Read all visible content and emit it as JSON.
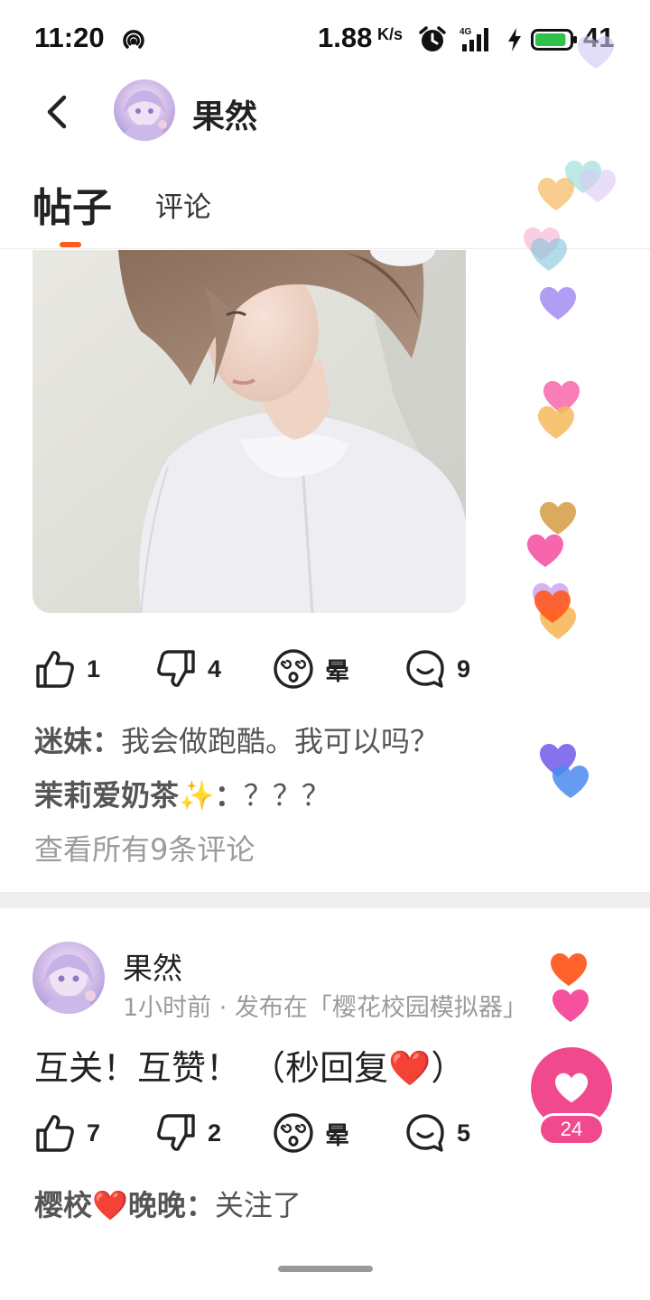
{
  "status_bar": {
    "time": "11:20",
    "net_speed": "1.88",
    "net_speed_unit": "K/s",
    "network_type": "4G",
    "battery_percent": "41",
    "battery_level": 0.41
  },
  "header": {
    "user_name": "果然"
  },
  "tabs": {
    "posts": "帖子",
    "comments": "评论"
  },
  "post1": {
    "actions": {
      "like_count": "1",
      "dislike_count": "4",
      "dizzy_label": "晕",
      "comment_count": "9"
    },
    "comments": [
      {
        "author": "迷妹：",
        "text": "我会做跑酷。我可以吗？"
      },
      {
        "author": "茉莉爱奶茶✨：",
        "text": "？？？"
      }
    ],
    "view_all": "查看所有9条评论"
  },
  "post2": {
    "author": "果然",
    "meta": "1小时前 · 发布在「樱花校园模拟器」",
    "text": "互关！互赞！ （秒回复❤️）",
    "actions": {
      "like_count": "7",
      "dislike_count": "2",
      "dizzy_label": "晕",
      "comment_count": "5"
    },
    "comments": [
      {
        "author": "樱校❤️晚晚：",
        "text": "关注了"
      }
    ]
  },
  "floating_like": {
    "count": "24"
  },
  "colors": {
    "accent": "#ff5a1f",
    "like_pink": "#f0498e",
    "muted_text": "#9b9b9b",
    "comment_text": "#555555",
    "divider": "#efefef"
  },
  "icons": {
    "back": "chevron-left-icon",
    "like": "thumbs-up-icon",
    "dislike": "thumbs-down-icon",
    "dizzy": "dizzy-face-icon",
    "comment": "speech-bubble-icon",
    "heart": "heart-icon"
  }
}
